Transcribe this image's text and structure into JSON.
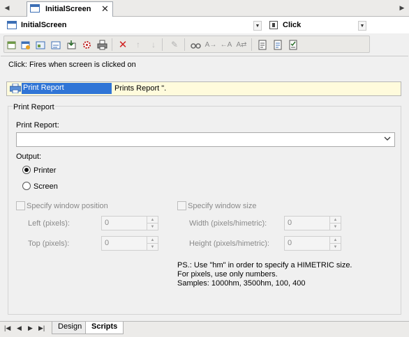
{
  "tabs": {
    "active": "InitialScreen",
    "close_glyph": "✕"
  },
  "selectors": {
    "object": "InitialScreen",
    "event": "Click"
  },
  "event_description": "Click: Fires when screen is clicked on",
  "command": {
    "name": "Print Report",
    "detail": "Prints Report \".",
    "icon": "printer-icon"
  },
  "group": {
    "title": "Print Report",
    "report_label": "Print Report:",
    "report_value": "",
    "output_label": "Output:",
    "output_options": [
      {
        "label": "Printer",
        "selected": true
      },
      {
        "label": "Screen",
        "selected": false
      }
    ],
    "position": {
      "check_label": "Specify window position",
      "left_label": "Left (pixels):",
      "left_value": "0",
      "top_label": "Top (pixels):",
      "top_value": "0"
    },
    "size": {
      "check_label": "Specify window size",
      "width_label": "Width (pixels/himetric):",
      "width_value": "0",
      "height_label": "Height (pixels/himetric):",
      "height_value": "0"
    },
    "note_lines": [
      "PS.: Use \"hm\" in order to specify a HIMETRIC size.",
      "For pixels, use only numbers.",
      "Samples: 1000hm, 3500hm, 100, 400"
    ]
  },
  "bottom_tabs": [
    {
      "label": "Design",
      "active": false
    },
    {
      "label": "Scripts",
      "active": true
    }
  ],
  "colors": {
    "selection": "#3075d6",
    "command_row_bg": "#fffbdc",
    "delete_red": "#d02020"
  }
}
